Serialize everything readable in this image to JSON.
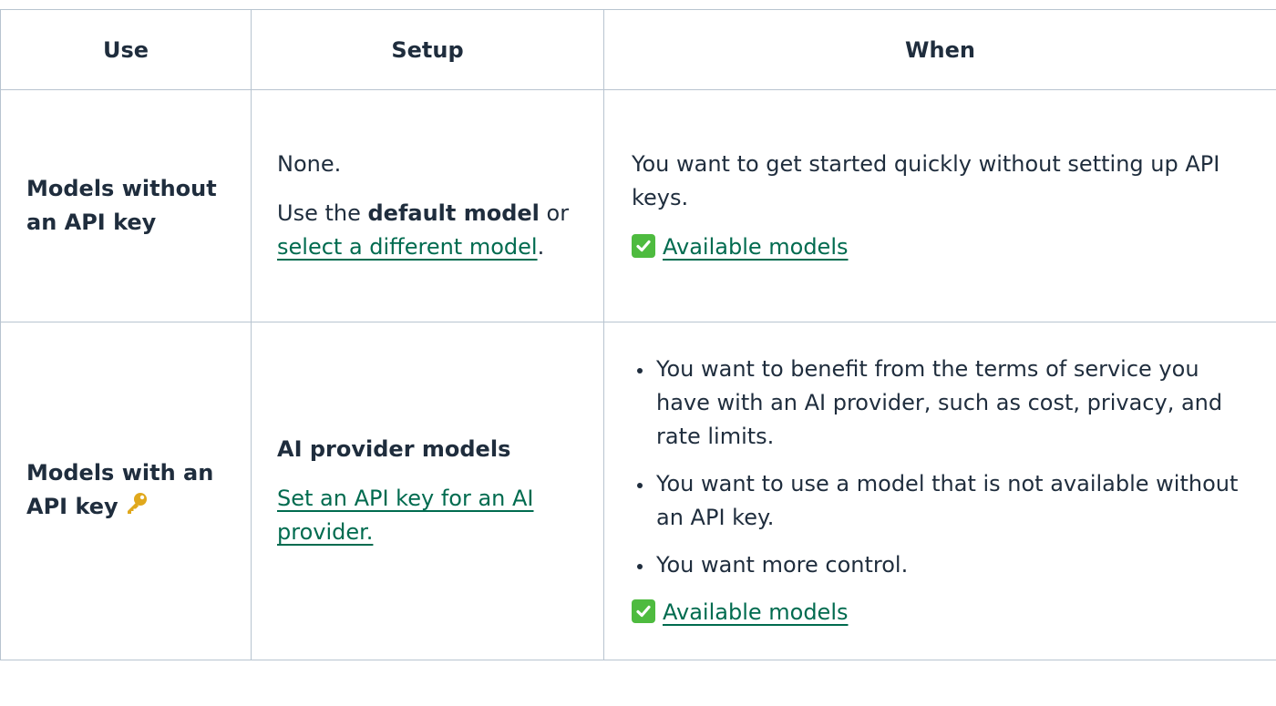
{
  "headers": {
    "use": "Use",
    "setup": "Setup",
    "when": "When"
  },
  "rows": [
    {
      "use_label": "Models without an API key",
      "setup": {
        "line1": "None.",
        "line2_prefix": "Use the ",
        "line2_bold": "default model",
        "line2_middle": " or ",
        "line2_link": "select a different model",
        "line2_suffix": "."
      },
      "when": {
        "text": "You want to get started quickly without setting up API keys.",
        "available_link": "Available models",
        "icon": "check-mark-button-icon"
      }
    },
    {
      "use_label": "Models with an API key",
      "use_icon": "key-icon",
      "setup": {
        "heading": "AI provider models",
        "link": "Set an API key for an AI provider."
      },
      "when": {
        "bullets": [
          "You want to benefit from the terms of service you have with an AI provider, such as cost, privacy, and rate limits.",
          "You want to use a model that is not available without an API key.",
          "You want more control."
        ],
        "available_link": "Available models",
        "icon": "check-mark-button-icon"
      }
    }
  ],
  "colors": {
    "link": "#006b4f",
    "text": "#1f2d3d",
    "border": "#b8c4d0",
    "check_bg": "#4ebb3f",
    "key": "#e0a81c"
  }
}
